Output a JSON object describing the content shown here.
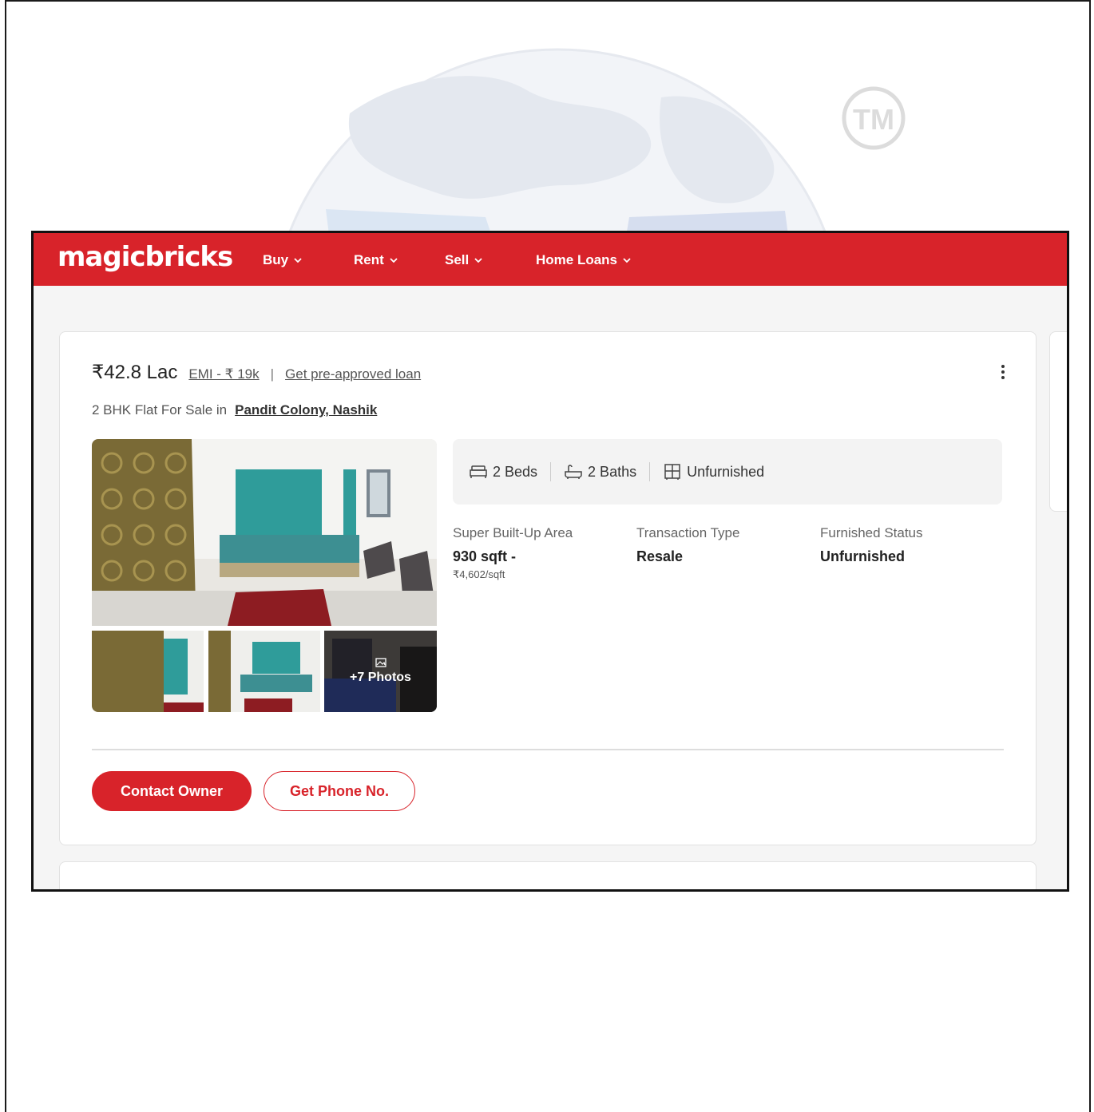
{
  "watermark": {
    "tm_text": "TM"
  },
  "navbar": {
    "logo": "magicbricks",
    "items": [
      {
        "label": "Buy"
      },
      {
        "label": "Rent"
      },
      {
        "label": "Sell"
      },
      {
        "label": "Home Loans"
      }
    ],
    "brand_color": "#d8232a"
  },
  "listing": {
    "price": "₹42.8 Lac",
    "emi": "EMI - ₹ 19k",
    "separator": "|",
    "loan_link": "Get pre-approved loan",
    "title": "2 BHK Flat For Sale in",
    "locality": "Pandit Colony, Nashik",
    "more_photos": "+7 Photos",
    "summary": {
      "beds": "2 Beds",
      "baths": "2 Baths",
      "furnishing": "Unfurnished"
    },
    "details": [
      {
        "label": "Super Built-Up Area",
        "value": "930 sqft -",
        "sub": "₹4,602/sqft"
      },
      {
        "label": "Transaction Type",
        "value": "Resale",
        "sub": ""
      },
      {
        "label": "Furnished Status",
        "value": "Unfurnished",
        "sub": ""
      }
    ],
    "actions": {
      "contact": "Contact Owner",
      "phone": "Get Phone No."
    }
  }
}
